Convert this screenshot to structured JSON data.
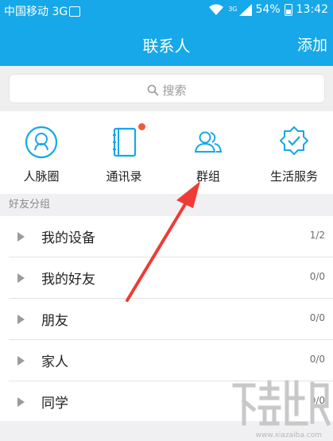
{
  "status_bar": {
    "carrier": "中国移动 3G",
    "network_type": "3G",
    "battery": "54%",
    "time": "13:42"
  },
  "app_bar": {
    "title": "联系人",
    "add_label": "添加"
  },
  "search": {
    "placeholder": "搜索"
  },
  "quick_access": [
    {
      "label": "人脉圈",
      "icon": "person-circle-icon"
    },
    {
      "label": "通讯录",
      "icon": "address-book-icon",
      "badge": true
    },
    {
      "label": "群组",
      "icon": "group-icon"
    },
    {
      "label": "生活服务",
      "icon": "service-badge-icon"
    }
  ],
  "friend_groups": {
    "header": "好友分组",
    "items": [
      {
        "name": "我的设备",
        "count": "1/2"
      },
      {
        "name": "我的好友",
        "count": "0/0"
      },
      {
        "name": "朋友",
        "count": "0/0"
      },
      {
        "name": "家人",
        "count": "0/0"
      },
      {
        "name": "同学",
        "count": "0/0"
      }
    ]
  },
  "watermark": {
    "text": "www.xiazaiba.com"
  },
  "colors": {
    "accent": "#16a8e8",
    "badge": "#f25a3a",
    "arrow": "#f03a36"
  }
}
